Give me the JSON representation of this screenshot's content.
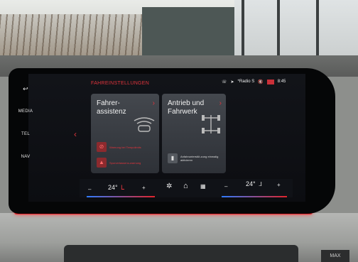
{
  "header": {
    "title": "FAHREINSTELLUNGEN",
    "radio": "*Radio S",
    "time": "8:45"
  },
  "side_nav": [
    {
      "label": "↩"
    },
    {
      "label": "MEDIA"
    },
    {
      "label": "TEL"
    },
    {
      "label": "NAV"
    }
  ],
  "tiles": [
    {
      "title": "Fahrer-\nassistenz",
      "items": [
        {
          "label": "Warnung bei Tempolimits"
        },
        {
          "label": "Spurverlassens-warnung"
        }
      ]
    },
    {
      "title": "Antrieb und\nFahrwerk",
      "items": [
        {
          "label": "Anfahrunterstüt-zung einmalig aktivieren"
        }
      ]
    }
  ],
  "climate": {
    "left_temp": "24°",
    "right_temp": "24°",
    "minus": "–",
    "plus": "+"
  },
  "button": {
    "max": "MAX"
  },
  "colors": {
    "accent": "#e0343c",
    "screen": "#0c0d11",
    "tile": "#3a3e44"
  }
}
